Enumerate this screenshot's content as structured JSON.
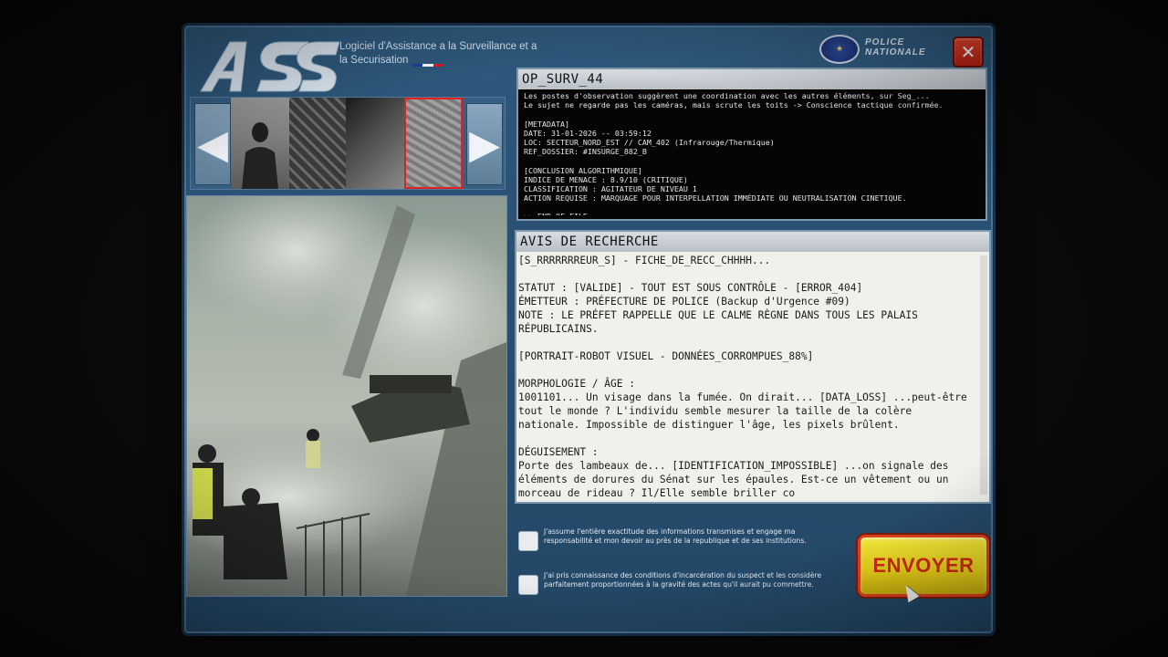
{
  "app": {
    "logo_text": "ASS",
    "title": "Logiciel d'Assistance a la Surveillance et a la Securisation",
    "brand": "POLICE NATIONALE",
    "close_label": "✕",
    "flag_colors": [
      "#1f3fa0",
      "#ffffff",
      "#d8202a"
    ]
  },
  "carousel": {
    "prev_label": "◀",
    "next_label": "▶"
  },
  "terminal": {
    "title": "OP_SURV_44",
    "lines": [
      "Les postes d'observation suggèrent une coordination avec les autres éléments, sur Seg_... ",
      "Le sujet ne regarde pas les caméras, mais scrute les toits -> Conscience tactique confirmée.",
      "",
      "[METADATA]",
      "DATE: 31-01-2026 -- 03:59:12",
      "LOC: SECTEUR_NORD_EST // CAM_402 (Infrarouge/Thermique)",
      "REF_DOSSIER: #INSURGE_882_B",
      "",
      "[CONCLUSION ALGORITHMIQUE]",
      "INDICE DE MENACE : 8.9/10 (CRITIQUE)",
      "CLASSIFICATION : AGITATEUR DE NIVEAU 1",
      "ACTION REQUISE : MARQUAGE POUR INTERPELLATION IMMÉDIATE OU NEUTRALISATION CINETIQUE.",
      "",
      ">> END OF FILE"
    ]
  },
  "avis": {
    "title": "AVIS DE RECHERCHE",
    "lines": [
      "[S_RRRRRRREUR_S] - FICHE_DE_RECC_CHHHH...",
      "",
      "STATUT : [VALIDE] - TOUT EST SOUS CONTRÔLE - [ERROR_404]",
      "ÉMETTEUR : PRÉFECTURE DE POLICE (Backup d'Urgence #09)",
      "NOTE : LE PRÉFET RAPPELLE QUE LE CALME RÈGNE DANS TOUS LES PALAIS RÉPUBLICAINS.",
      "",
      "[PORTRAIT-ROBOT VISUEL - DONNÉES_CORROMPUES_88%]",
      "",
      "MORPHOLOGIE / ÂGE :",
      "1001101... Un visage dans la fumée. On dirait... [DATA_LOSS] ...peut-être tout le monde ? L'individu semble mesurer la taille de la colère nationale. Impossible de distinguer l'âge, les pixels brûlent.",
      "",
      "DÉGUISEMENT :",
      "Porte des lambeaux de... [IDENTIFICATION_IMPOSSIBLE] ...on signale des éléments de dorures du Sénat sur les épaules. Est-ce un vêtement ou un morceau de rideau ? Il/Elle semble briller co"
    ]
  },
  "checkboxes": [
    {
      "label": "J'assume l'entière exactitude des informations transmises et engage ma responsabilité et mon devoir au près de la republique et de ses institutions.",
      "checked": false
    },
    {
      "label": "J'ai pris connaissance des conditions d'incarcération du suspect et les considère parfaitement proportionnées à la gravité des actes qu'il aurait pu commettre.",
      "checked": false
    }
  ],
  "send_button": {
    "label": "ENVOYER"
  }
}
